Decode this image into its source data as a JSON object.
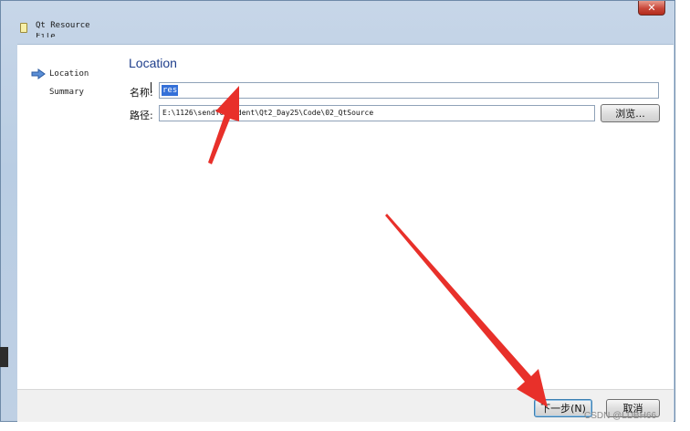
{
  "window": {
    "title": "Qt Resource",
    "title_line2": "File",
    "close_glyph": "✕"
  },
  "steps": [
    {
      "label": "Location",
      "active": true
    },
    {
      "label": "Summary",
      "active": false
    }
  ],
  "page": {
    "heading": "Location"
  },
  "form": {
    "name_label": "名称:",
    "name_value": "res",
    "path_label": "路径:",
    "path_value": "E:\\1126\\sendToStudent\\Qt2_Day25\\Code\\02_QtSource",
    "browse_label": "浏览..."
  },
  "buttons": {
    "next_label": "下一步(N)",
    "cancel_label": "取消"
  },
  "watermark": "CSDN @LDBH66",
  "colors": {
    "annotation_arrow": "#e8302a",
    "heading": "#1f3f8c",
    "selection": "#3470d8"
  }
}
